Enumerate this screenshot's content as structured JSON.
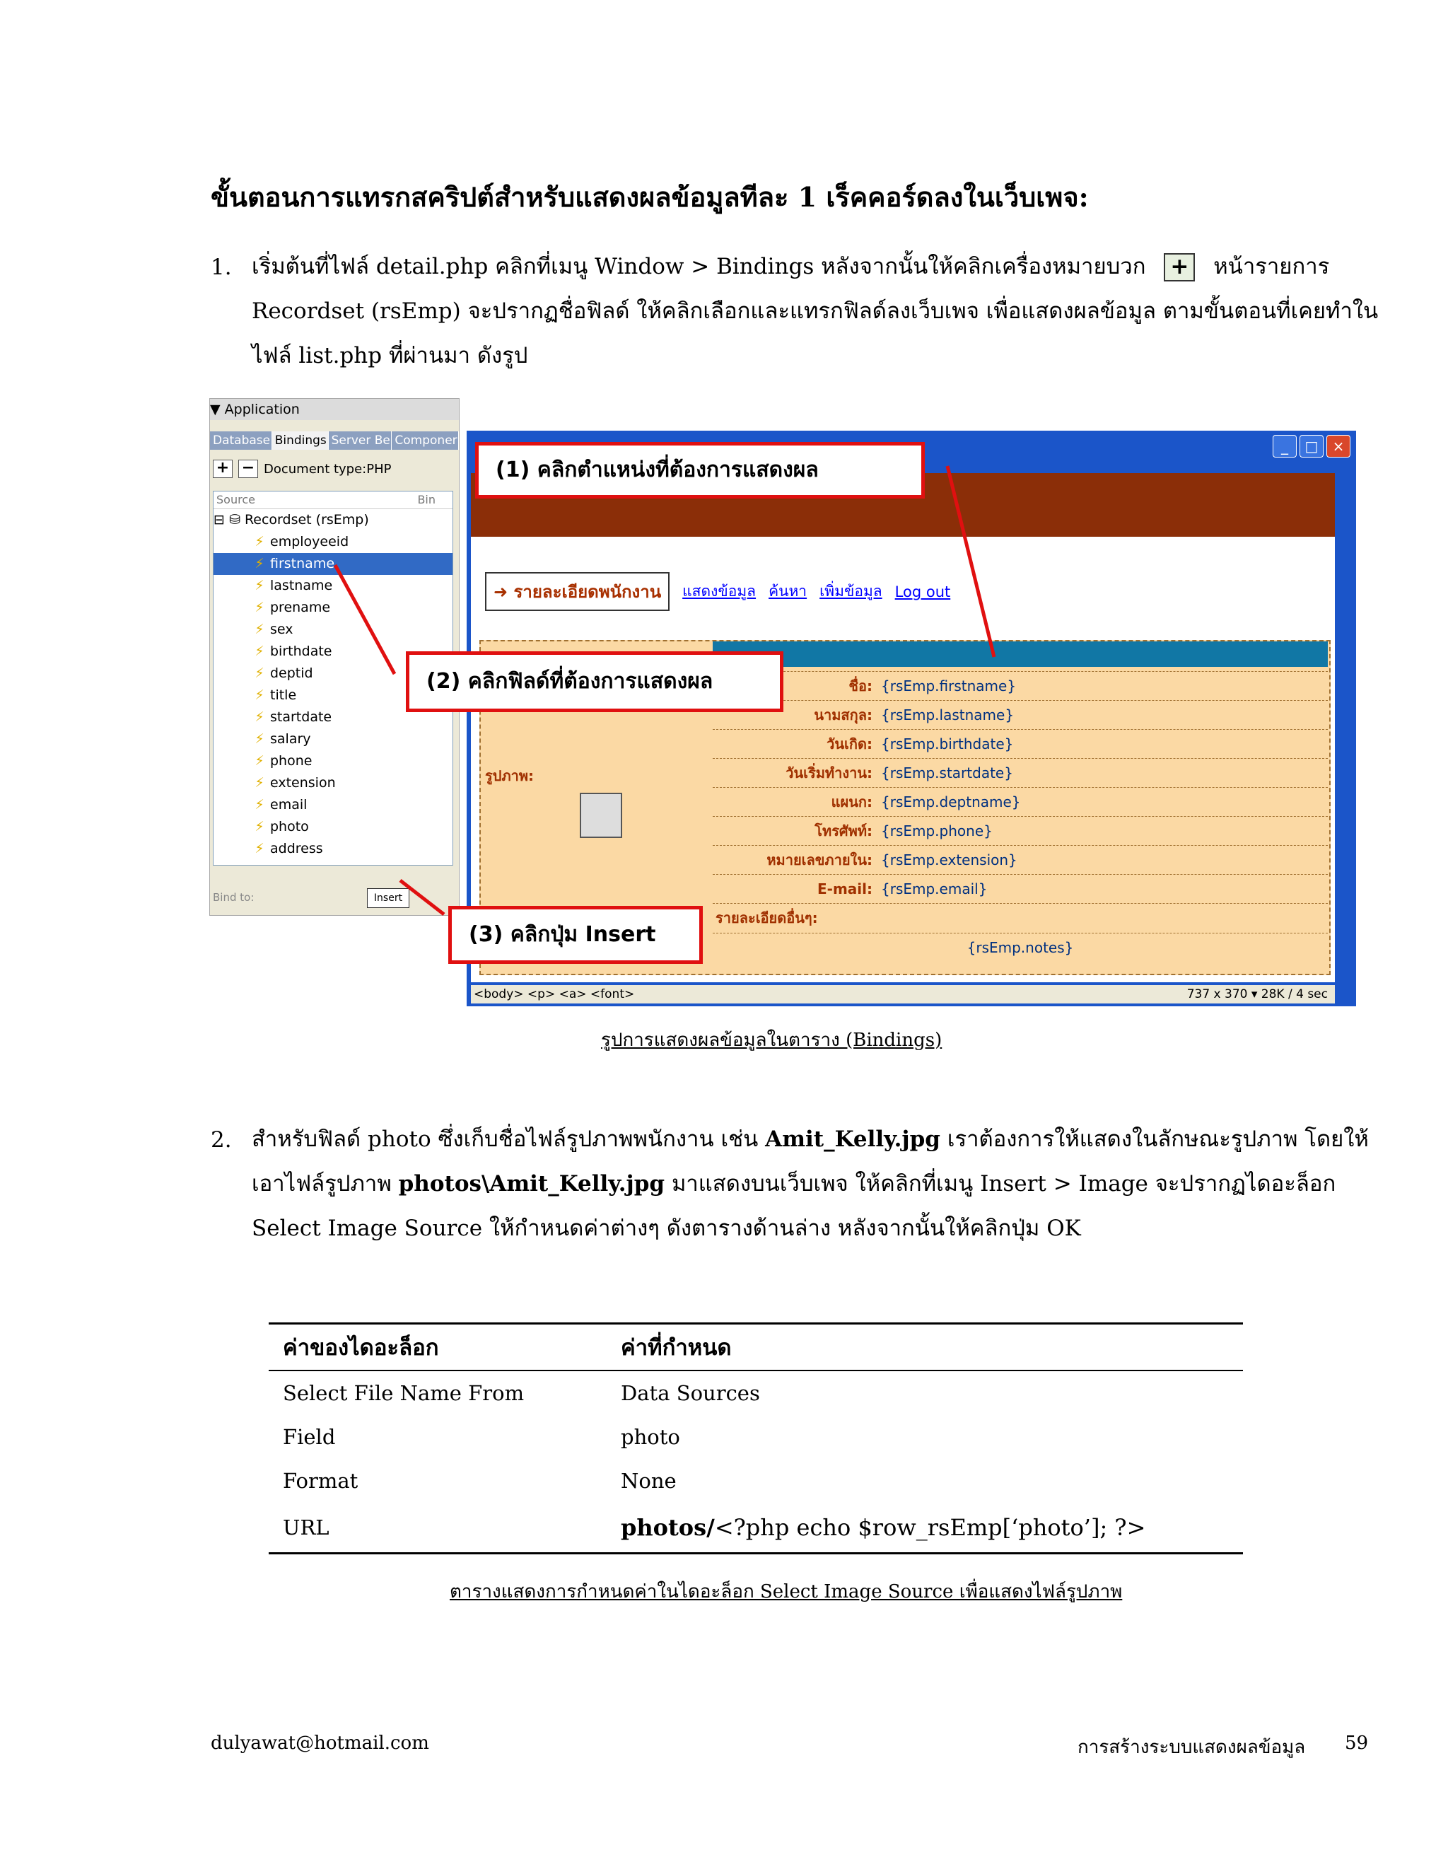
{
  "heading": "ขั้นตอนการแทรกสคริปต์สำหรับแสดงผลข้อมูลทีละ 1 เร็คคอร์ดลงในเว็บเพจ:",
  "step1": {
    "number": "1.",
    "line1": "เริ่มต้นที่ไฟล์ detail.php คลิกที่เมนู Window > Bindings หลังจากนั้นให้คลิกเครื่องหมายบวก",
    "line1_tail": "หน้ารายการ",
    "line2": "Recordset (rsEmp) จะปรากฏชื่อฟิลด์ ให้คลิกเลือกและแทรกฟิลด์ลงเว็บเพจ เพื่อแสดงผลข้อมูล ตามขั้นตอนที่เคยทำใน",
    "line3": "ไฟล์ list.php ที่ผ่านมา ดังรูป"
  },
  "figure": {
    "panel": {
      "title": "▼ Application",
      "tabs": [
        "Database",
        "Bindings",
        "Server Be",
        "Componer"
      ],
      "document_type": "Document type:PHP",
      "source_label": "Source",
      "bind_label": "Bin",
      "recordset": "Recordset (rsEmp)",
      "fields": [
        "employeeid",
        "firstname",
        "lastname",
        "prename",
        "sex",
        "birthdate",
        "deptid",
        "title",
        "startdate",
        "salary",
        "phone",
        "extension",
        "email",
        "photo",
        "address"
      ],
      "bind_to": "Bind to:",
      "insert": "Insert"
    },
    "page": {
      "nav_button": "รายละเอียดพนักงาน",
      "links": [
        "แสดงข้อมูล",
        "ค้นหา",
        "เพิ่มข้อมูล",
        "Log out"
      ],
      "photo_label": "รูปภาพ:",
      "rows": [
        {
          "label": "ชื่อ:",
          "value": "{rsEmp.firstname}"
        },
        {
          "label": "นามสกุล:",
          "value": "{rsEmp.lastname}"
        },
        {
          "label": "วันเกิด:",
          "value": "{rsEmp.birthdate}"
        },
        {
          "label": "วันเริ่มทำงาน:",
          "value": "{rsEmp.startdate}"
        },
        {
          "label": "แผนก:",
          "value": "{rsEmp.deptname}"
        },
        {
          "label": "โทรศัพท์:",
          "value": "{rsEmp.phone}"
        },
        {
          "label": "หมายเลขภายใน:",
          "value": "{rsEmp.extension}"
        },
        {
          "label": "E-mail:",
          "value": "{rsEmp.email}"
        },
        {
          "label": "รายละเอียดอื่นๆ:",
          "value": ""
        }
      ],
      "notes": "{rsEmp.notes}",
      "status_left": "<body> <p> <a> <font>",
      "status_right": "737 x 370 ▾ 28K / 4 sec"
    },
    "callouts": {
      "c1_num": "(1)",
      "c1": "คลิกตำแหน่งที่ต้องการแสดงผล",
      "c2_num": "(2)",
      "c2": "คลิกฟิลด์ที่ต้องการแสดงผล",
      "c3_num": "(3)",
      "c3": "คลิกปุ่ม Insert"
    }
  },
  "figure_caption": "รูปการแสดงผลข้อมูลในตาราง (Bindings)",
  "step2": {
    "number": "2.",
    "line1_a": "สำหรับฟิลด์ photo ซึ่งเก็บชื่อไฟล์รูปภาพพนักงาน เช่น",
    "line1_bold": "Amit_Kelly.jpg",
    "line1_b": "เราต้องการให้แสดงในลักษณะรูปภาพ โดยให้",
    "line2_a": "เอาไฟล์รูปภาพ",
    "line2_bold": "photos\\Amit_Kelly.jpg",
    "line2_b": "มาแสดงบนเว็บเพจ   ให้คลิกที่เมนู Insert > Image จะปรากฏไดอะล็อก",
    "line3": "Select Image Source ให้กำหนดค่าต่างๆ ดังตารางด้านล่าง หลังจากนั้นให้คลิกปุ่ม OK"
  },
  "settings_table": {
    "headers": [
      "ค่าของไดอะล็อก",
      "ค่าที่กำหนด"
    ],
    "rows": [
      [
        "Select File Name From",
        "Data Sources"
      ],
      [
        "Field",
        "photo"
      ],
      [
        "Format",
        "None"
      ]
    ],
    "url_label": "URL",
    "url_bold": "photos/",
    "url_rest": "<?php echo $row_rsEmp[‘photo’]; ?>"
  },
  "table_caption": "ตารางแสดงการกำหนดค่าในไดอะล็อก Select Image Source เพื่อแสดงไฟล์รูปภาพ",
  "footer": {
    "email": "dulyawat@hotmail.com",
    "title": "การสร้างระบบแสดงผลข้อมูล",
    "page": "59"
  },
  "colors": {
    "callout_border": "#e01010",
    "banner": "#8b2e08",
    "table_fill": "#fbd9a4",
    "selection": "#316ac5"
  }
}
